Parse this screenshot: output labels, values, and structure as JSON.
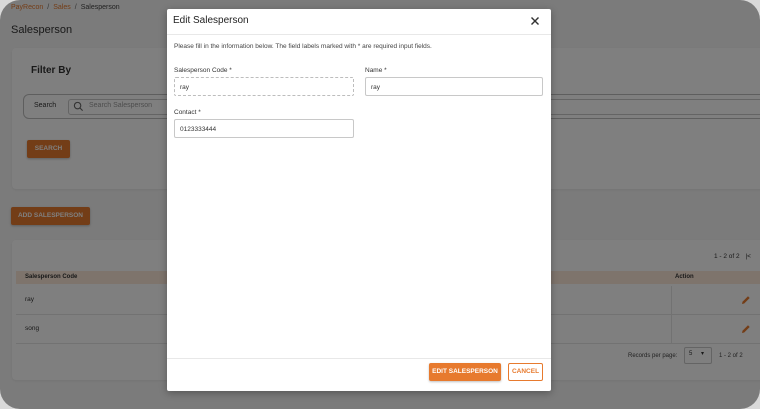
{
  "breadcrumb": {
    "home": "PayRecon",
    "section": "Sales",
    "current": "Salesperson"
  },
  "page_title": "Salesperson",
  "filter": {
    "title": "Filter By",
    "search_label": "Search",
    "search_placeholder": "Search Salesperson",
    "search_button": "SEARCH"
  },
  "add_button": "ADD SALESPERSON",
  "table": {
    "pager_top": "1 - 2 of 2",
    "columns": {
      "code": "Salesperson Code",
      "action": "Action"
    },
    "rows": [
      {
        "code": "ray"
      },
      {
        "code": "song"
      }
    ],
    "footer": {
      "records_label": "Records per page:",
      "records_value": "5",
      "pager": "1 - 2 of 2"
    }
  },
  "modal": {
    "title": "Edit Salesperson",
    "info": "Please fill in the information below. The field labels marked with * are required input fields.",
    "fields": {
      "code": {
        "label": "Salesperson Code *",
        "value": "ray"
      },
      "name": {
        "label": "Name *",
        "value": "ray"
      },
      "contact": {
        "label": "Contact *",
        "value": "0123333444"
      }
    },
    "submit": "EDIT SALESPERSON",
    "cancel": "CANCEL"
  },
  "colors": {
    "accent": "#e77a2e",
    "header_row": "#fde9d9"
  },
  "icons": [
    "search-icon",
    "pencil-icon",
    "close-icon",
    "chevron-left-icon",
    "chevron-down-icon"
  ]
}
